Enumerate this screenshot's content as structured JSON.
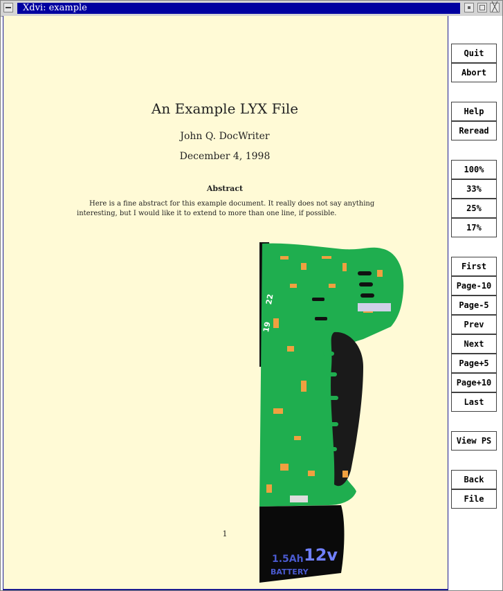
{
  "window": {
    "title": "Xdvi:  example"
  },
  "titlebar_icons": {
    "menu": "window-menu-icon",
    "minimize": "minimize-icon",
    "maximize": "maximize-icon",
    "close": "close-icon",
    "close_glyph": "╳"
  },
  "document": {
    "title": "An Example LYX File",
    "author": "John Q. DocWriter",
    "date": "December 4, 1998",
    "abstract_heading": "Abstract",
    "abstract_text": "Here is a fine abstract for this example document. It really does not say anything interesting, but I would like it to extend to more than one line, if possible.",
    "page_number": "1",
    "battery_label_1": "1.5Ah",
    "battery_label_2": "BATTERY",
    "battery_voltage": "12v",
    "dial_numbers": [
      "22",
      "19"
    ]
  },
  "colors": {
    "page_background": "#fffad6",
    "title_bar_active": "#0000a0",
    "drill_green": "#1fae4f",
    "drill_orange": "#f0a040"
  },
  "sidebar": {
    "buttons": [
      {
        "label": "Quit"
      },
      {
        "label": "Abort"
      },
      {
        "label": "Help"
      },
      {
        "label": "Reread"
      },
      {
        "label": "100%"
      },
      {
        "label": "33%"
      },
      {
        "label": "25%"
      },
      {
        "label": "17%"
      },
      {
        "label": "First"
      },
      {
        "label": "Page-10"
      },
      {
        "label": "Page-5"
      },
      {
        "label": "Prev"
      },
      {
        "label": "Next"
      },
      {
        "label": "Page+5"
      },
      {
        "label": "Page+10"
      },
      {
        "label": "Last"
      },
      {
        "label": "View PS"
      },
      {
        "label": "Back"
      },
      {
        "label": "File"
      }
    ]
  }
}
